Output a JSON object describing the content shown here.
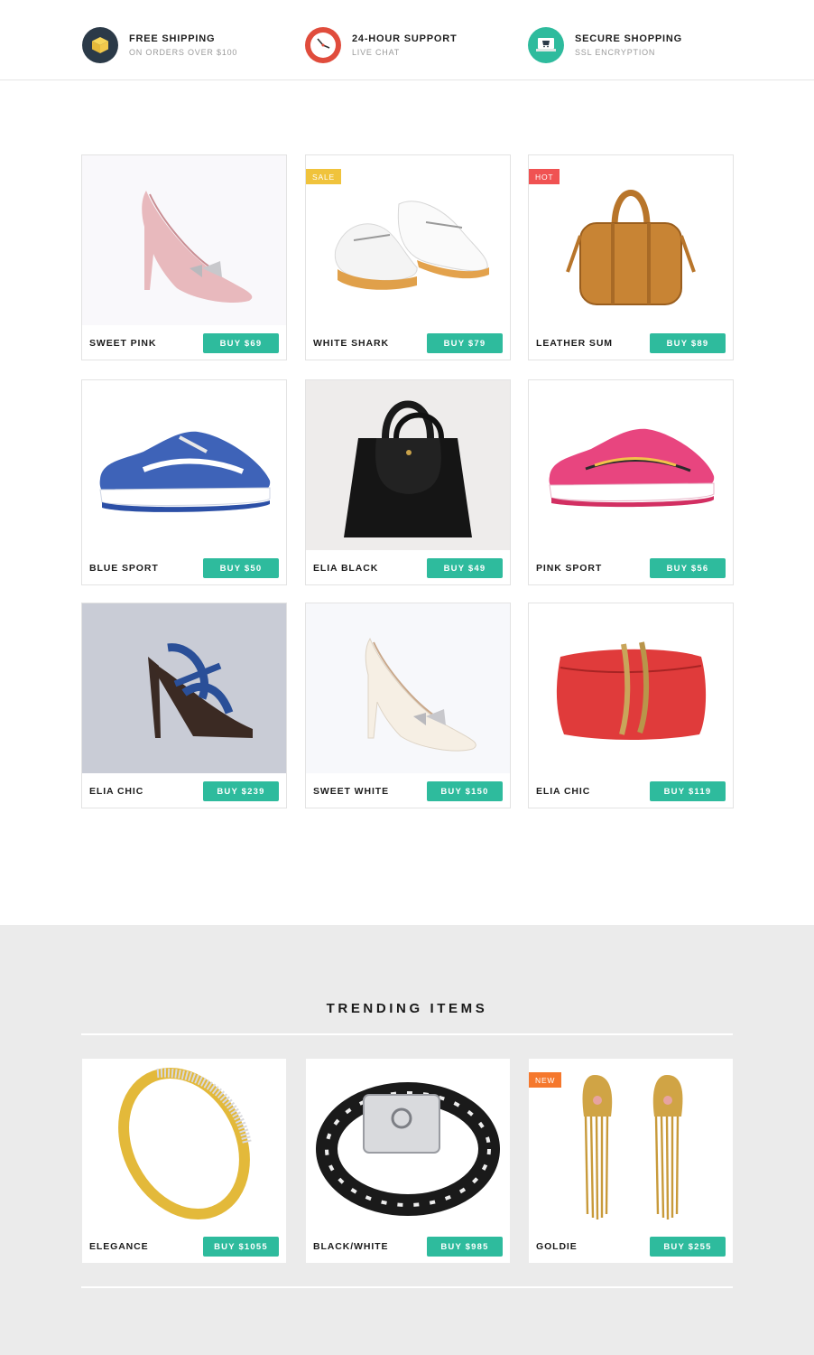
{
  "colors": {
    "accent": "#2ebb9d",
    "badge_sale": "#f0c33c",
    "badge_hot": "#f05252",
    "badge_new": "#f5782d",
    "trending_bg": "#ebebeb"
  },
  "features": [
    {
      "title": "FREE SHIPPING",
      "subtitle": "ON ORDERS OVER $100",
      "icon": "box-icon",
      "icon_color": "#2b3a48"
    },
    {
      "title": "24-HOUR SUPPORT",
      "subtitle": "LIVE CHAT",
      "icon": "clock-icon",
      "icon_color": "#e04c3c"
    },
    {
      "title": "SECURE SHOPPING",
      "subtitle": "SSL ENCRYPTION",
      "icon": "cart-icon",
      "icon_color": "#2ebb9d"
    }
  ],
  "products": [
    {
      "name": "SWEET PINK",
      "buy_label": "BUY $69",
      "image": "pink-pump-image",
      "badge": ""
    },
    {
      "name": "WHITE SHARK",
      "buy_label": "BUY $79",
      "image": "white-shoes-image",
      "badge": "SALE"
    },
    {
      "name": "LEATHER SUM",
      "buy_label": "BUY $89",
      "image": "leather-bag-image",
      "badge": "HOT"
    },
    {
      "name": "BLUE SPORT",
      "buy_label": "BUY $50",
      "image": "blue-sneaker-image",
      "badge": ""
    },
    {
      "name": "ELIA BLACK",
      "buy_label": "BUY $49",
      "image": "black-handbag-image",
      "badge": ""
    },
    {
      "name": "PINK SPORT",
      "buy_label": "BUY $56",
      "image": "pink-sneaker-image",
      "badge": ""
    },
    {
      "name": "ELIA CHIC",
      "buy_label": "BUY $239",
      "image": "blue-heel-image",
      "badge": ""
    },
    {
      "name": "SWEET WHITE",
      "buy_label": "BUY $150",
      "image": "white-pump-image",
      "badge": ""
    },
    {
      "name": "ELIA CHIC",
      "buy_label": "BUY $119",
      "image": "red-clutch-image",
      "badge": ""
    }
  ],
  "trending": {
    "title": "TRENDING ITEMS",
    "items": [
      {
        "name": "ELEGANCE",
        "buy_label": "BUY $1055",
        "image": "gold-bangle-image",
        "badge": ""
      },
      {
        "name": "BLACK/WHITE",
        "buy_label": "BUY $985",
        "image": "bead-bracelet-image",
        "badge": ""
      },
      {
        "name": "GOLDIE",
        "buy_label": "BUY $255",
        "image": "gold-earrings-image",
        "badge": "NEW"
      }
    ]
  }
}
